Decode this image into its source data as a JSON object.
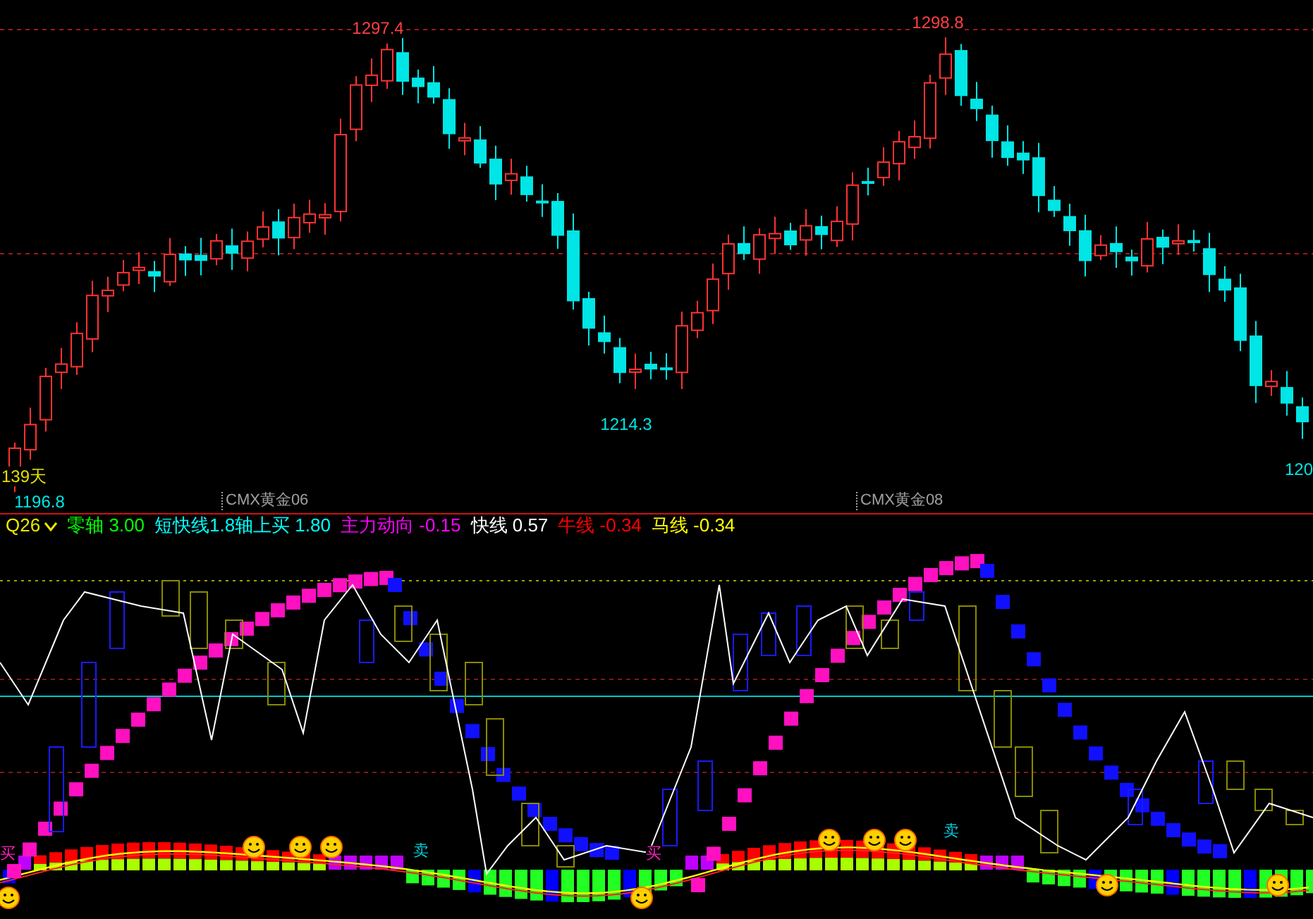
{
  "price_chart": {
    "labels": [
      {
        "text": "1297.4",
        "kind": "high"
      },
      {
        "text": "1298.8",
        "kind": "high"
      },
      {
        "text": "1214.3",
        "kind": "low"
      },
      {
        "text": "1196.8",
        "kind": "low"
      },
      {
        "text": "139天",
        "kind": "count"
      },
      {
        "text": "120",
        "kind": "low"
      }
    ],
    "contracts": [
      "CMX黄金06",
      "CMX黄金08"
    ]
  },
  "indicator": {
    "name": "Q26",
    "lines": [
      {
        "label": "零轴",
        "value": "3.00",
        "color": "#00ff00"
      },
      {
        "label": "短快线1.8轴上买",
        "value": "1.80",
        "color": "#00ffff"
      },
      {
        "label": "主力动向",
        "value": "-0.15",
        "color": "#ff00ff"
      },
      {
        "label": "快线",
        "value": "0.57",
        "color": "#ffffff"
      },
      {
        "label": "牛线",
        "value": "-0.34",
        "color": "#ff0000"
      },
      {
        "label": "马线",
        "value": "-0.34",
        "color": "#ffff00"
      }
    ],
    "signals": [
      {
        "text": "买",
        "kind": "buy"
      },
      {
        "text": "卖",
        "kind": "sell"
      },
      {
        "text": "买",
        "kind": "buy"
      },
      {
        "text": "卖",
        "kind": "sell"
      }
    ]
  }
}
